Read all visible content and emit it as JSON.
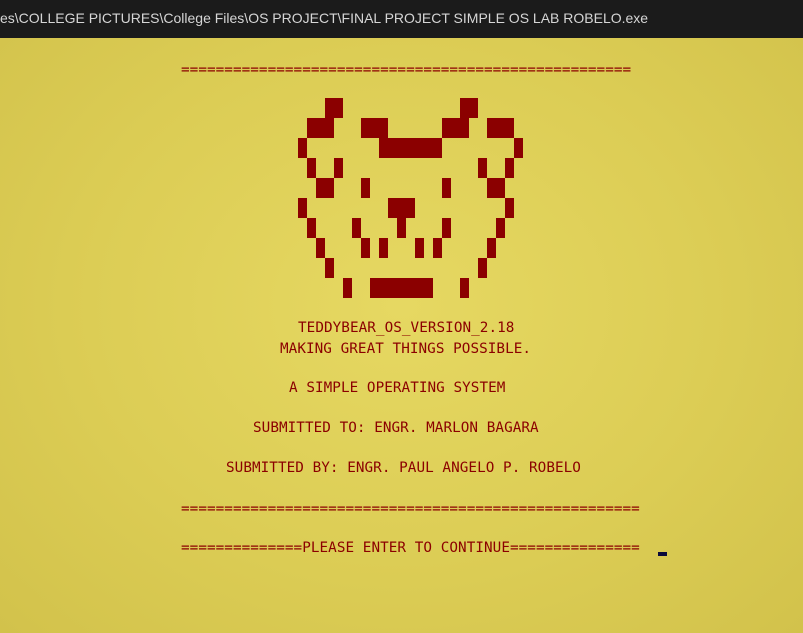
{
  "window": {
    "title": "es\\COLLEGE PICTURES\\College Files\\OS PROJECT\\FINAL PROJECT SIMPLE OS LAB ROBELO.exe"
  },
  "console": {
    "top_rule": "====================================================",
    "os_version": "TEDDYBEAR_OS_VERSION_2.18",
    "tagline": "MAKING GREAT THINGS POSSIBLE.",
    "description": "A SIMPLE OPERATING SYSTEM",
    "submitted_to": "SUBMITTED TO: ENGR. MARLON BAGARA",
    "submitted_by": "SUBMITTED BY: ENGR. PAUL ANGELO P. ROBELO",
    "bottom_rule": "=====================================================",
    "prompt": "==============PLEASE ENTER TO CONTINUE==============="
  },
  "art": {
    "name": "teddy-bear-ascii-art",
    "color": "#8b0000"
  },
  "colors": {
    "background": "#d8c84e",
    "text": "#8b0000",
    "titlebar": "#1b1b1b"
  }
}
